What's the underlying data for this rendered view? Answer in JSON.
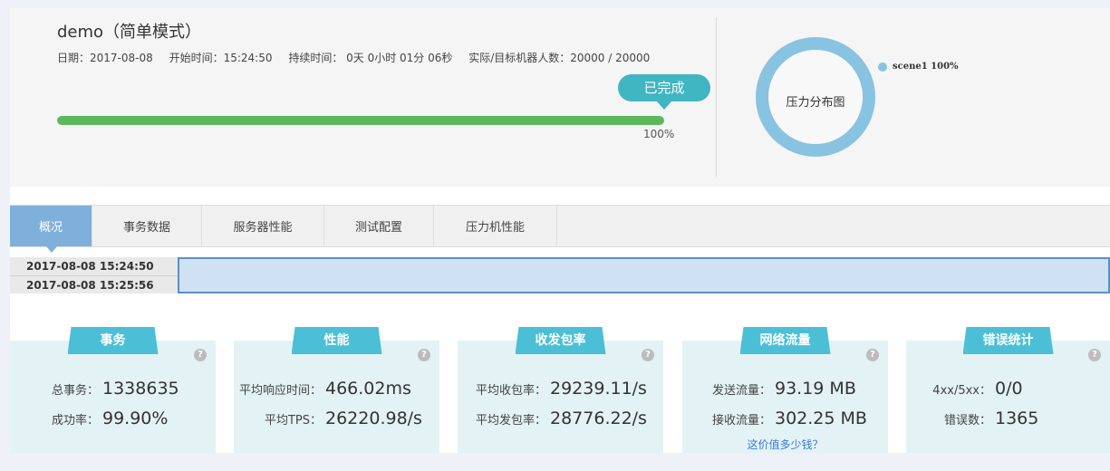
{
  "header": {
    "title": "demo（简单模式）",
    "date": "日期：2017-08-08",
    "start": "开始时间：15:24:50",
    "duration": "持续时间：  0天 0小时 01分 06秒",
    "bots": "实际/目标机器人数：20000 / 20000",
    "status": "已完成",
    "progress_label": "100%",
    "progress_value": 1.0
  },
  "pressure": {
    "center_label": "压力分布图",
    "legend": "scene1  100%",
    "color": "#89c3e2"
  },
  "tabs": [
    "概况",
    "事务数据",
    "服务器性能",
    "测试配置",
    "压力机性能"
  ],
  "timeline": {
    "start": "2017-08-08 15:24:50",
    "end": "2017-08-08 15:25:56"
  },
  "cards": {
    "transactions": {
      "title": "事务",
      "total_label": "总事务：",
      "total": "1338635",
      "success_label": "成功率：",
      "success": "99.90%"
    },
    "performance": {
      "title": "性能",
      "rt_label": "平均响应时间：",
      "rt": "466.02ms",
      "tps_label": "平均TPS：",
      "tps": "26220.98/s"
    },
    "packets": {
      "title": "收发包率",
      "recv_label": "平均收包率：",
      "recv": "29239.11/s",
      "send_label": "平均发包率：",
      "send": "28776.22/s"
    },
    "network": {
      "title": "网络流量",
      "send_label": "发送流量：",
      "send": "93.19 MB",
      "recv_label": "接收流量：",
      "recv": "302.25 MB",
      "link": "这价值多少钱？"
    },
    "errors": {
      "title": "错误统计",
      "codes_label": "4xx/5xx：",
      "codes": "0/0",
      "count_label": "错误数：",
      "count": "1365"
    }
  },
  "colors": {
    "progress": "#5cb85c",
    "status": "#3fb6c2",
    "tab_active": "#7fb0db",
    "card_head": "#4bbfd6",
    "card_bg": "#e3f2f5"
  }
}
